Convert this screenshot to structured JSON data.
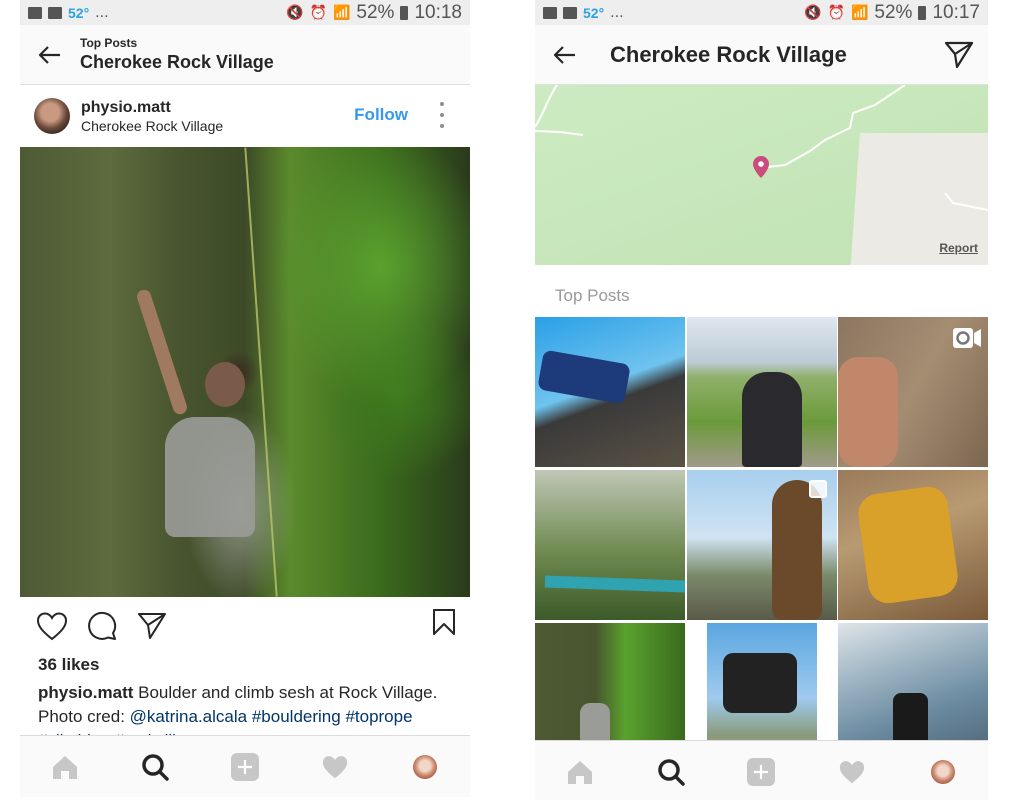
{
  "left_screen": {
    "status_bar": {
      "temperature": "52°",
      "overflow": "...",
      "battery": "52%",
      "time": "10:18"
    },
    "header": {
      "subtitle": "Top Posts",
      "title": "Cherokee Rock Village"
    },
    "post": {
      "username": "physio.matt",
      "location": "Cherokee Rock Village",
      "follow_label": "Follow",
      "likes": "36 likes",
      "caption_user": "physio.matt",
      "caption_text": " Boulder and climb sesh at Rock Village.",
      "caption_line2_prefix": "Photo cred: ",
      "mention": "@katrina.alcala",
      "hashtags": [
        "#bouldering",
        "#toprope"
      ],
      "caption_truncated": "#climbing #rockvill..."
    }
  },
  "right_screen": {
    "status_bar": {
      "temperature": "52°",
      "overflow": "...",
      "battery": "52%",
      "time": "10:17"
    },
    "header": {
      "title": "Cherokee Rock Village"
    },
    "map": {
      "report_label": "Report",
      "pin_color": "#c94c7c"
    },
    "section_title": "Top Posts",
    "grid": [
      {
        "subject": "blue truck on rock slope"
      },
      {
        "subject": "hiker with backpack overlooking lake"
      },
      {
        "subject": "shirtless climber on rock",
        "badge": "video"
      },
      {
        "subject": "acro yoga in forest"
      },
      {
        "subject": "woman with long hair at overlook",
        "badge": "multiple"
      },
      {
        "subject": "person in hammock with sleeping bag"
      },
      {
        "subject": "climber on mossy rock wall"
      },
      {
        "subject": "three friends at overlook"
      },
      {
        "subject": "person crouching on rocky outcrop"
      }
    ]
  },
  "tab_bar": {
    "items": [
      {
        "name": "home",
        "active": false
      },
      {
        "name": "search",
        "active": true
      },
      {
        "name": "new-post",
        "active": false
      },
      {
        "name": "activity",
        "active": false
      },
      {
        "name": "profile",
        "active": false
      }
    ]
  },
  "colors": {
    "link_blue": "#3897f0",
    "hashtag_blue": "#003569",
    "text": "#262626",
    "muted": "#999999",
    "temp_blue": "#29a3e0"
  }
}
